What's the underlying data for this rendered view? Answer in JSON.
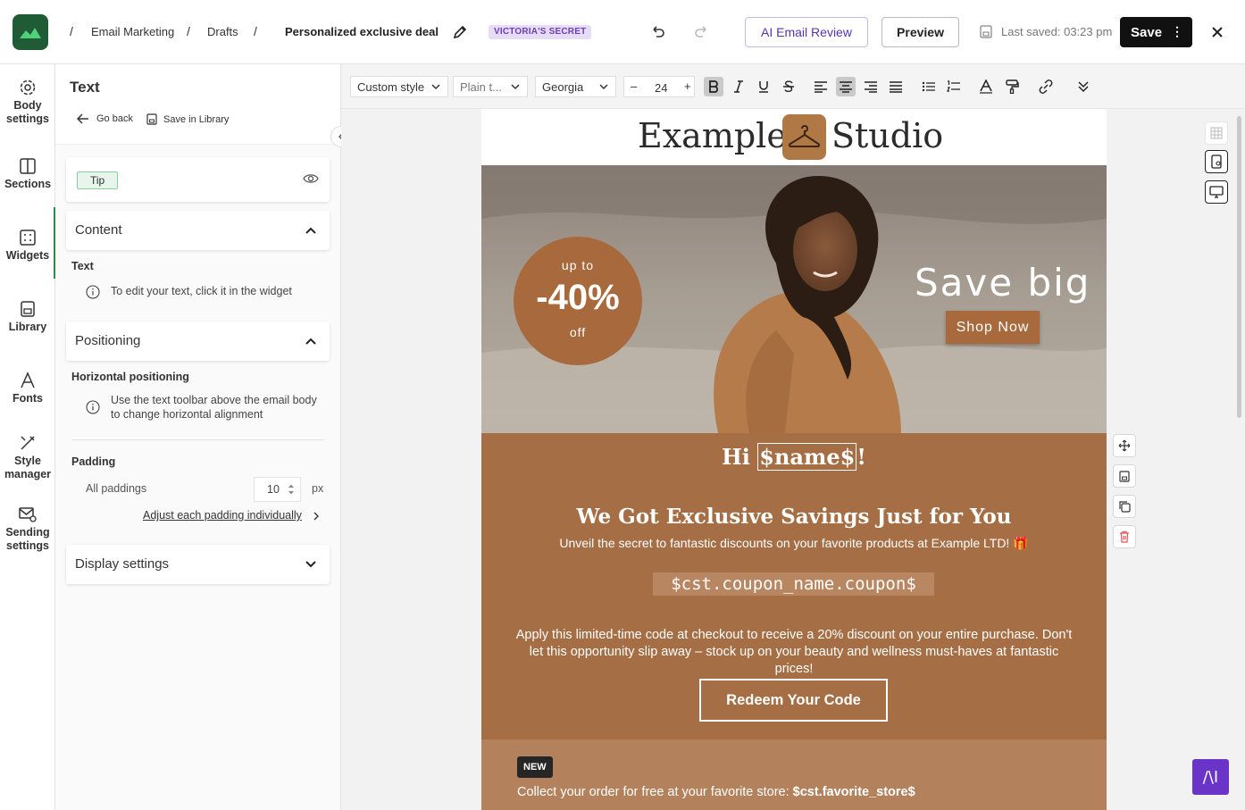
{
  "header": {
    "breadcrumbs": [
      "Email Marketing",
      "Drafts"
    ],
    "title": "Personalized exclusive deal",
    "brand_badge": "VICTORIA'S SECRET",
    "ai_review_label": "AI Email Review",
    "preview_label": "Preview",
    "last_saved": "Last saved: 03:23 pm",
    "save_label": "Save"
  },
  "rail": {
    "items": [
      {
        "label_1": "Body",
        "label_2": "settings"
      },
      {
        "label_1": "Sections"
      },
      {
        "label_1": "Widgets"
      },
      {
        "label_1": "Library"
      },
      {
        "label_1": "Fonts"
      },
      {
        "label_1": "Style",
        "label_2": "manager"
      },
      {
        "label_1": "Sending",
        "label_2": "settings"
      }
    ]
  },
  "panel": {
    "title": "Text",
    "go_back": "Go back",
    "save_in_library": "Save in Library",
    "tip": "Tip",
    "content_title": "Content",
    "text_label": "Text",
    "text_info": "To edit your text, click it in the widget",
    "positioning_title": "Positioning",
    "horizontal_label": "Horizontal positioning",
    "horizontal_info": "Use the text toolbar above the email body to change horizontal alignment",
    "padding_label": "Padding",
    "all_paddings": "All paddings",
    "padding_value": "10",
    "padding_unit": "px",
    "adjust_link": "Adjust each padding individually",
    "display_title": "Display settings"
  },
  "toolbar": {
    "style": "Custom style",
    "format": "Plain t...",
    "font": "Georgia",
    "size": "24"
  },
  "email": {
    "logo_left": "Example",
    "logo_right": "Studio",
    "badge_up": "up to",
    "badge_pct": "-40%",
    "badge_off": "off",
    "hero_title": "Save big",
    "shop_button": "Shop Now",
    "hi_prefix": "Hi ",
    "hi_name": "$name$",
    "hi_suffix": "!",
    "headline": "We Got Exclusive Savings Just for You",
    "subline": "Unveil the secret to fantastic discounts on your favorite products at Example LTD! 🎁",
    "coupon": "$cst.coupon_name.coupon$",
    "description": "Apply this limited-time code at checkout to receive a 20% discount on your entire purchase. Don't let this opportunity slip away – stock up on your beauty and wellness must-haves at fantastic prices!",
    "redeem_button": "Redeem Your Code",
    "new_badge": "NEW",
    "footer_prefix": "Collect your order for free at your favorite store: ",
    "footer_store": "$cst.favorite_store$"
  },
  "fab_label": "/\\I",
  "colors": {
    "brand_green": "#1f5b34",
    "accent_purple": "#6a34c8",
    "email_brown": "#a66e44",
    "email_light_brown": "#b3825c"
  }
}
